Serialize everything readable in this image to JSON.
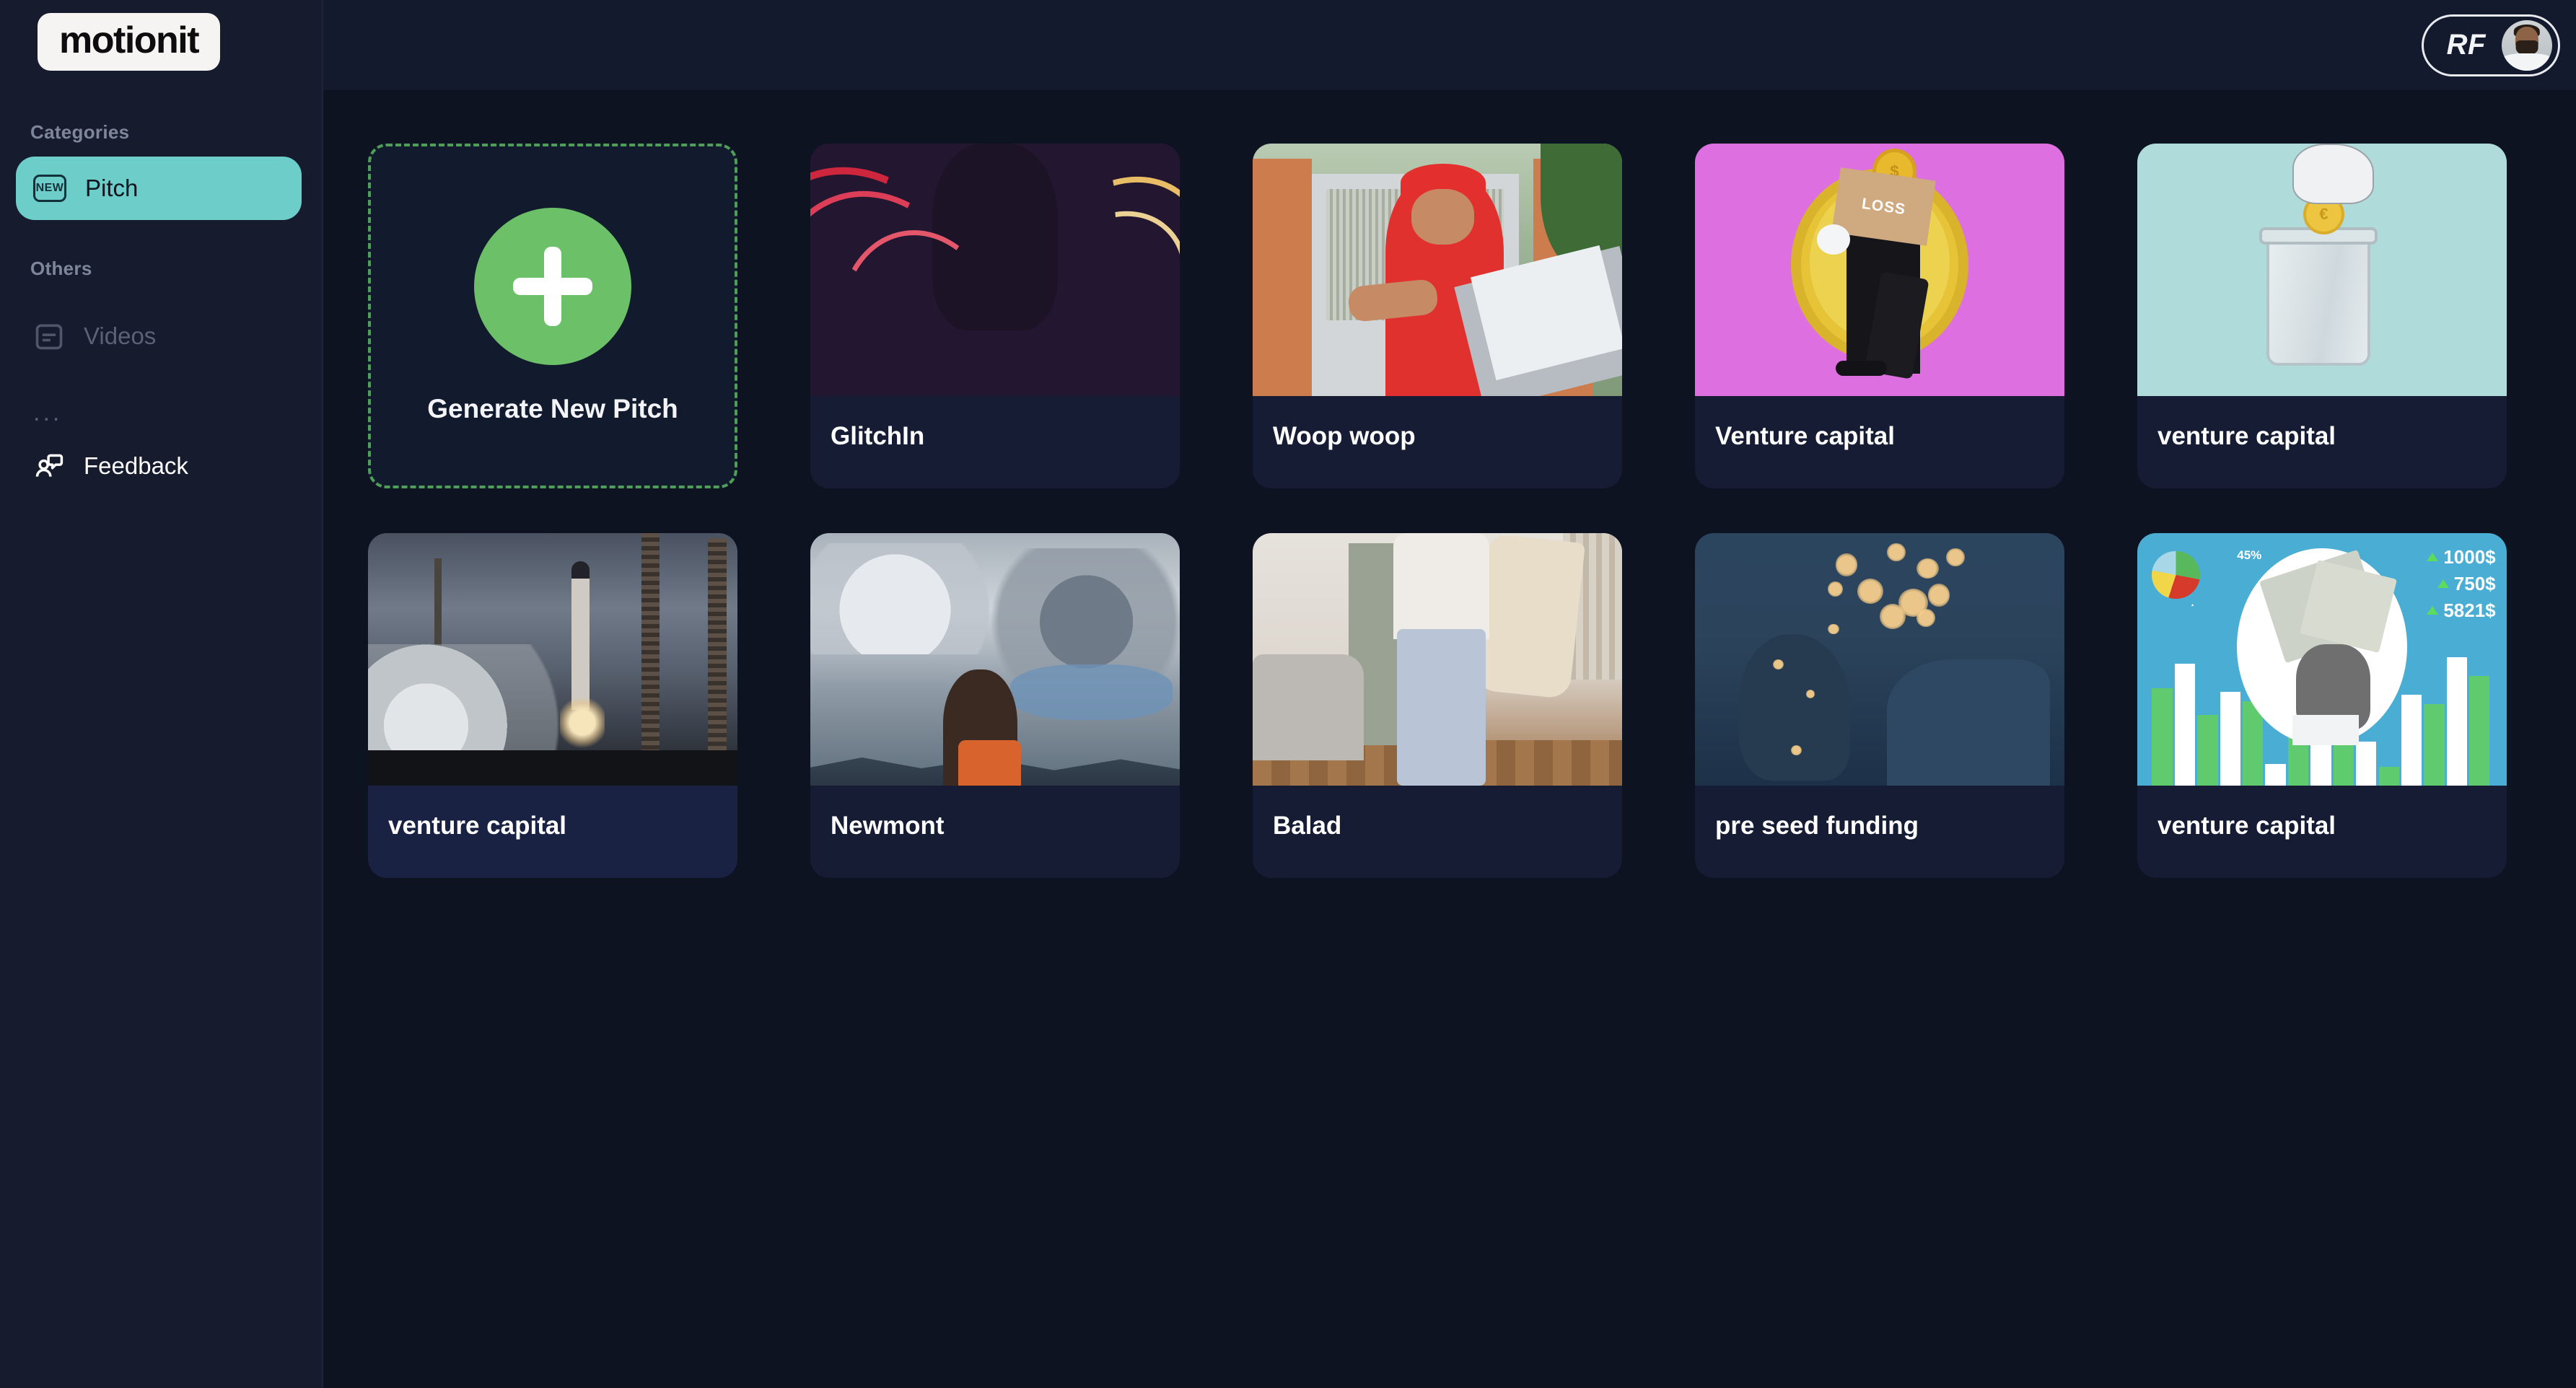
{
  "app": {
    "brand": "motionit",
    "background_color": "#0e1322",
    "sidebar_color": "#161b2e",
    "accent_color": "#6dcdc8",
    "generate_accent": "#6cc067"
  },
  "sidebar": {
    "logo": "motionit",
    "sections": [
      {
        "label": "Categories"
      },
      {
        "label": "Others"
      }
    ],
    "categories_label": "Categories",
    "others_label": "Others",
    "items": [
      {
        "label": "Pitch",
        "icon": "new-badge-icon",
        "active": true
      },
      {
        "label": "Videos",
        "icon": "video-card-icon",
        "active": false
      }
    ],
    "overflow": "...",
    "feedback": {
      "label": "Feedback",
      "icon": "feedback-chat-icon"
    },
    "new_badge_text": "NEW"
  },
  "topbar": {
    "user": {
      "initials": "RF",
      "avatar": "user-avatar-photo"
    }
  },
  "main": {
    "generate_card": {
      "label": "Generate New Pitch",
      "icon": "plus-icon"
    },
    "cards": [
      {
        "title": "GlitchIn",
        "art": "t-glitch",
        "hover": false
      },
      {
        "title": "Woop woop",
        "art": "t-delivery",
        "hover": false
      },
      {
        "title": "Venture capital",
        "art": "t-loss",
        "hover": false
      },
      {
        "title": "venture capital",
        "art": "t-jar",
        "hover": false
      },
      {
        "title": "venture capital",
        "art": "t-rocket",
        "hover": true
      },
      {
        "title": "Newmont",
        "art": "t-clouds",
        "hover": false
      },
      {
        "title": "Balad",
        "art": "t-shop",
        "hover": false
      },
      {
        "title": "pre seed funding",
        "art": "t-bokeh",
        "hover": false
      },
      {
        "title": "venture capital",
        "art": "t-fin",
        "hover": false
      }
    ]
  },
  "chart_card": {
    "type": "bar",
    "pie_label": "45%",
    "values": [
      "1000$",
      "750$",
      "5821$"
    ],
    "bars": [
      62,
      78,
      45,
      60,
      54,
      14,
      36,
      66,
      48,
      28,
      12,
      58,
      52,
      82,
      70
    ]
  }
}
